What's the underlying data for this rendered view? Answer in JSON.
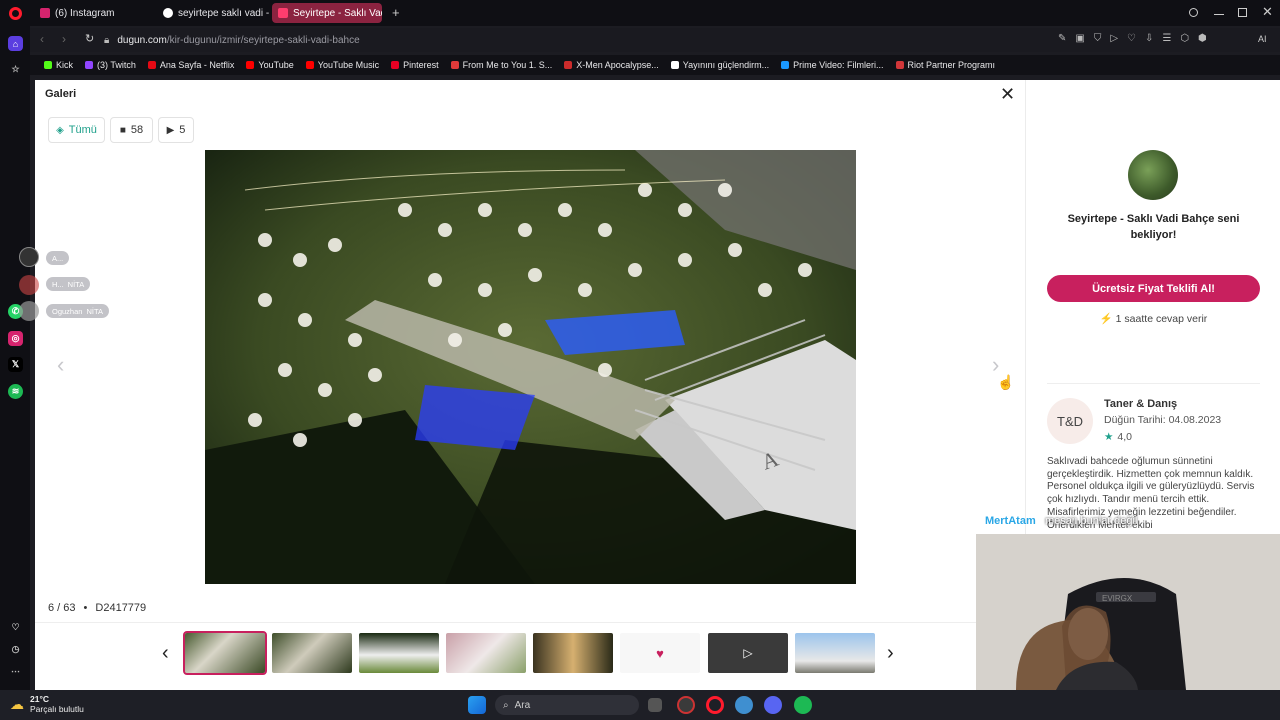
{
  "browser": {
    "tabs": [
      {
        "label": "(6) Instagram",
        "color": "#d6246e"
      },
      {
        "label": "seyirtepe saklı vadi - Goo",
        "color": "#ffffff"
      },
      {
        "label": "Seyirtepe - Saklı Vadi Bah",
        "color": "#ff3d6e"
      }
    ],
    "new_tab": "+",
    "url_domain": "dugun.com",
    "url_path": "/kir-dugunu/izmir/seyirtepe-sakli-vadi-bahce",
    "bookmarks": [
      {
        "label": "Kick",
        "color": "#53fc18"
      },
      {
        "label": "(3) Twitch",
        "color": "#9146ff"
      },
      {
        "label": "Ana Sayfa - Netflix",
        "color": "#e50914"
      },
      {
        "label": "YouTube",
        "color": "#ff0000"
      },
      {
        "label": "YouTube Music",
        "color": "#ff0000"
      },
      {
        "label": "Pinterest",
        "color": "#e60023"
      },
      {
        "label": "From Me to You 1. S...",
        "color": "#e03a3a"
      },
      {
        "label": "X-Men Apocalypse...",
        "color": "#cc2b2b"
      },
      {
        "label": "Yayınını güçlendirm...",
        "color": "#ffffff"
      },
      {
        "label": "Prime Video: Filmleri...",
        "color": "#1a98ff"
      },
      {
        "label": "Riot Partner Programı",
        "color": "#d13639"
      }
    ],
    "ai_label": "AI"
  },
  "gallery": {
    "title": "Galeri",
    "filters": {
      "all": "Tümü",
      "photos": "58",
      "videos": "5"
    },
    "counter": "6 / 63",
    "bullet": "•",
    "photo_id": "D2417779"
  },
  "vendor": {
    "heading": "Seyirtepe - Saklı Vadi Bahçe seni bekliyor!",
    "quote_button": "Ücretsiz Fiyat Teklifi Al!",
    "reply_note": "1 saatte cevap verir",
    "review": {
      "initials": "T&D",
      "name": "Taner & Danış",
      "date": "Düğün Tarihi: 04.08.2023",
      "rating": "4,0",
      "text": "Saklıvadi bahcede oğlumun sünnetini gerçekleştirdik. Hizmetten çok memnun kaldık. Personel oldukça ilgili ve güleryüzlüydü. Servis çok hızlıydı. Tandır menü tercih ettik. Misafirlerimiz yemeğin lezzetini beğendiler. Önerdikleri Mehter ekibi"
    }
  },
  "stream_overlay": {
    "chat_user": "MertAtam",
    "chat_message": "mesajı bunlar değil",
    "chips": [
      "A...",
      "H...",
      "NİTA",
      "Oguzhan",
      "NİTA"
    ]
  },
  "taskbar": {
    "temp": "21°C",
    "weather": "Parçalı bulutlu",
    "search": "Ara"
  },
  "colors": {
    "accent": "#c8205e",
    "teal": "#1fa08b",
    "star": "#1fa08b"
  }
}
